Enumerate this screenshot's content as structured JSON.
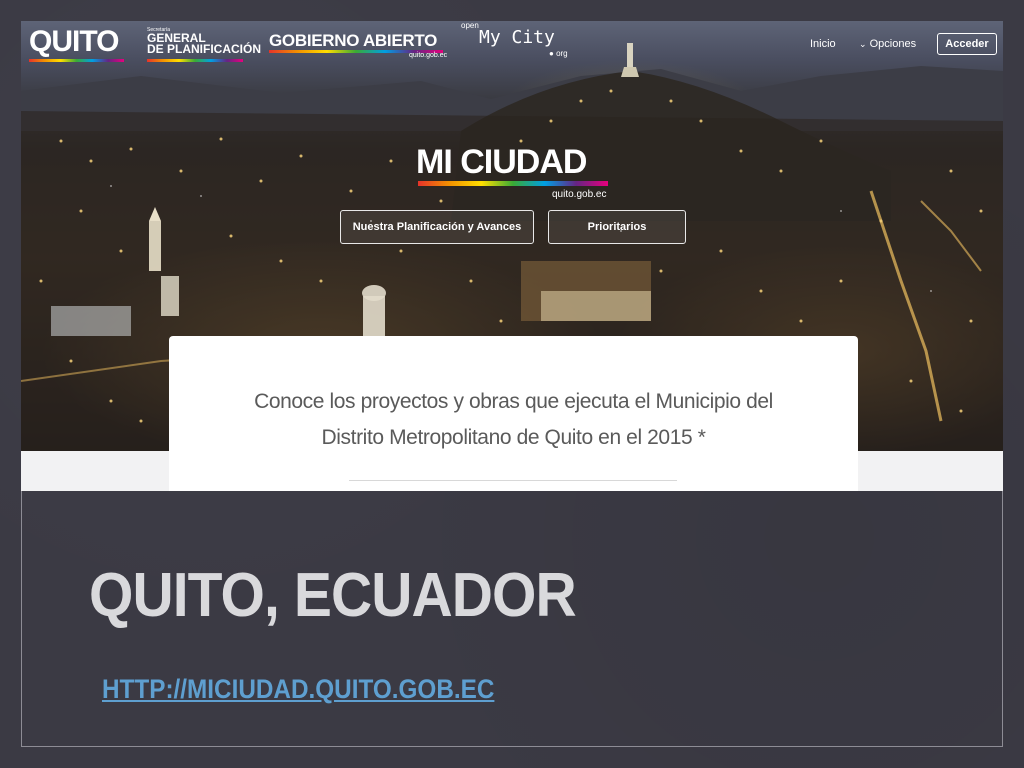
{
  "header": {
    "logo_quito": "QUITO",
    "secretaria_small": "Secretaría",
    "secretaria_line1": "GENERAL",
    "secretaria_line2": "DE PLANIFICACIÓN",
    "gobierno_abierto": "GOBIERNO ABIERTO",
    "gobierno_domain": "quito.gob.ec",
    "open_label": "open",
    "mycity_label": "My City",
    "org_label": "org",
    "nav": {
      "inicio": "Inicio",
      "opciones": "Opciones",
      "acceder": "Acceder"
    }
  },
  "hero": {
    "brand": "MI CIUDAD",
    "domain": "quito.gob.ec",
    "buttons": {
      "planificacion": "Nuestra Planificación y Avances",
      "prioritarios": "Prioritarios"
    }
  },
  "card": {
    "line1": "Conoce los proyectos y obras que ejecuta el Municipio del",
    "line2": "Distrito Metropolitano de Quito en el 2015 *"
  },
  "slide": {
    "title": "QUITO, ECUADOR",
    "link": "HTTP://MICIUDAD.QUITO.GOB.EC"
  },
  "colors": {
    "slide_background": "#3b3a44",
    "link": "#5e9fd0",
    "title": "#d9d9dc",
    "brand_stripe": [
      "#e6332a",
      "#f39200",
      "#ffde00",
      "#3aaa35",
      "#009fe3",
      "#662483",
      "#e6007e"
    ]
  },
  "icons": {
    "opciones_chevron": "chevron-down-icon"
  }
}
